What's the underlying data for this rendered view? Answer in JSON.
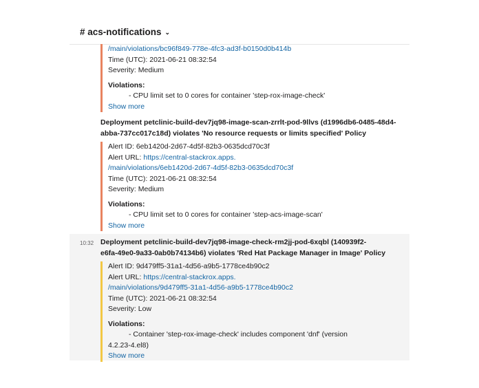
{
  "channel": {
    "name": "# acs-notifications",
    "chevron": "⌄"
  },
  "messages": [
    {
      "lines": {
        "url_path": "/main/violations/bc96f849-778e-4fc3-ad3f-b0150d0b414b",
        "time": "Time (UTC): 2021-06-21 08:32:54",
        "severity": "Severity: Medium",
        "violations_label": "Violations:",
        "violation": "- CPU limit set to 0 cores for container 'step-rox-image-check'",
        "show_more": "Show more"
      }
    },
    {
      "title_1": "Deployment petclinic-build-dev7jq98-image-scan-zrrlt-pod-9llvs (d1996db6-0485-48d4-",
      "title_2": "abba-737cc017c18d) violates 'No resource requests or limits specified' Policy",
      "alert_id": "Alert ID: 6eb1420d-2d67-4d5f-82b3-0635dcd70c3f",
      "alert_url_label": "Alert URL: ",
      "alert_url": "https://central-stackrox.apps.",
      "url_path": "/main/violations/6eb1420d-2d67-4d5f-82b3-0635dcd70c3f",
      "time": "Time (UTC): 2021-06-21 08:32:54",
      "severity": "Severity: Medium",
      "violations_label": "Violations:",
      "violation": "- CPU limit set to 0 cores for container 'step-acs-image-scan'",
      "show_more": "Show more"
    },
    {
      "timestamp": "10:32",
      "title_1": "Deployment petclinic-build-dev7jq98-image-check-rm2jj-pod-6xqbl (140939f2-",
      "title_2": "e6fa-49e0-9a33-0ab0b74134b6) violates 'Red Hat Package Manager in Image' Policy",
      "alert_id": "Alert ID: 9d479ff5-31a1-4d56-a9b5-1778ce4b90c2",
      "alert_url_label": "Alert URL: ",
      "alert_url": "https://central-stackrox.apps.",
      "url_path": "/main/violations/9d479ff5-31a1-4d56-a9b5-1778ce4b90c2",
      "time": "Time (UTC): 2021-06-21 08:32:54",
      "severity": "Severity: Low",
      "violations_label": "Violations:",
      "violation_1": "- Container 'step-rox-image-check' includes component 'dnf' (version",
      "violation_2": "4.2.23-4.el8)",
      "show_more": "Show more"
    }
  ],
  "colors": {
    "accent_orange": "#e8835f",
    "accent_yellow": "#f2c744",
    "link": "#1264a3"
  }
}
